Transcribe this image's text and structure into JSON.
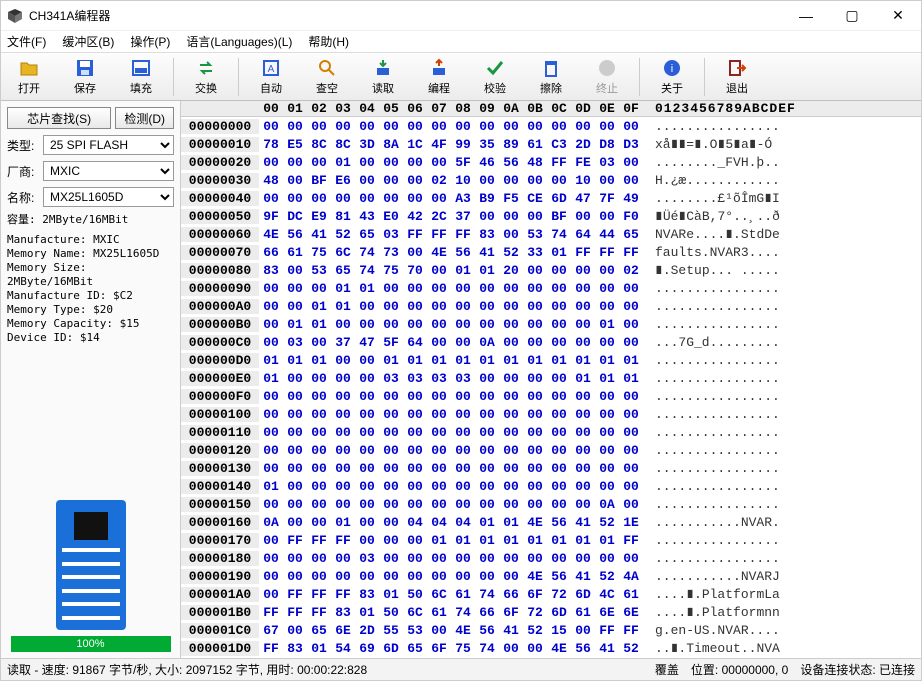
{
  "win": {
    "title": "CH341A编程器"
  },
  "menu": {
    "file": "文件(F)",
    "buffer": "缓冲区(B)",
    "op": "操作(P)",
    "lang": "语言(Languages)(L)",
    "help": "帮助(H)"
  },
  "toolbar": {
    "open": "打开",
    "save": "保存",
    "fill": "填充",
    "swap": "交换",
    "auto": "自动",
    "blank": "查空",
    "read": "读取",
    "prog": "编程",
    "verify": "校验",
    "erase": "擦除",
    "stop": "终止",
    "about": "关于",
    "exit": "退出"
  },
  "left": {
    "search_label": "芯片查找(S)",
    "detect_label": "检测(D)",
    "type_label": "类型:",
    "type_value": "25 SPI FLASH",
    "maker_label": "厂商:",
    "maker_value": "MXIC",
    "name_label": "名称:",
    "name_value": "MX25L1605D",
    "cap": "容量: 2MByte/16MBit",
    "info": "Manufacture: MXIC\nMemory Name: MX25L1605D\nMemory Size: 2MByte/16MBit\nManufacture ID: $C2\nMemory Type: $20\nMemory Capacity: $15\nDevice ID: $14",
    "progress": "100%"
  },
  "hex": {
    "header_bytes": [
      "00",
      "01",
      "02",
      "03",
      "04",
      "05",
      "06",
      "07",
      "08",
      "09",
      "0A",
      "0B",
      "0C",
      "0D",
      "0E",
      "0F"
    ],
    "header_asc": "0123456789ABCDEF",
    "rows": [
      {
        "a": "00000000",
        "b": [
          "00",
          "00",
          "00",
          "00",
          "00",
          "00",
          "00",
          "00",
          "00",
          "00",
          "00",
          "00",
          "00",
          "00",
          "00",
          "00"
        ],
        "s": "................"
      },
      {
        "a": "00000010",
        "b": [
          "78",
          "E5",
          "8C",
          "8C",
          "3D",
          "8A",
          "1C",
          "4F",
          "99",
          "35",
          "89",
          "61",
          "C3",
          "2D",
          "D8",
          "D3"
        ],
        "s": "xå∎∎=∎.O∎5∎a∎-Ó"
      },
      {
        "a": "00000020",
        "b": [
          "00",
          "00",
          "00",
          "01",
          "00",
          "00",
          "00",
          "00",
          "5F",
          "46",
          "56",
          "48",
          "FF",
          "FE",
          "03",
          "00"
        ],
        "s": "........_FVH.þ.."
      },
      {
        "a": "00000030",
        "b": [
          "48",
          "00",
          "BF",
          "E6",
          "00",
          "00",
          "00",
          "02",
          "10",
          "00",
          "00",
          "00",
          "00",
          "10",
          "00",
          "00"
        ],
        "s": "H.¿æ............"
      },
      {
        "a": "00000040",
        "b": [
          "00",
          "00",
          "00",
          "00",
          "00",
          "00",
          "00",
          "00",
          "A3",
          "B9",
          "F5",
          "CE",
          "6D",
          "47",
          "7F",
          "49"
        ],
        "s": "........£¹õÎmG∎I"
      },
      {
        "a": "00000050",
        "b": [
          "9F",
          "DC",
          "E9",
          "81",
          "43",
          "E0",
          "42",
          "2C",
          "37",
          "00",
          "00",
          "00",
          "BF",
          "00",
          "00",
          "F0"
        ],
        "s": "∎Üé∎CàB,7°..¸..ð"
      },
      {
        "a": "00000060",
        "b": [
          "4E",
          "56",
          "41",
          "52",
          "65",
          "03",
          "FF",
          "FF",
          "FF",
          "83",
          "00",
          "53",
          "74",
          "64",
          "44",
          "65"
        ],
        "s": "NVARe....∎.StdDe"
      },
      {
        "a": "00000070",
        "b": [
          "66",
          "61",
          "75",
          "6C",
          "74",
          "73",
          "00",
          "4E",
          "56",
          "41",
          "52",
          "33",
          "01",
          "FF",
          "FF",
          "FF"
        ],
        "s": "faults.NVAR3...."
      },
      {
        "a": "00000080",
        "b": [
          "83",
          "00",
          "53",
          "65",
          "74",
          "75",
          "70",
          "00",
          "01",
          "01",
          "20",
          "00",
          "00",
          "00",
          "00",
          "02"
        ],
        "s": "∎.Setup... ....."
      },
      {
        "a": "00000090",
        "b": [
          "00",
          "00",
          "00",
          "01",
          "01",
          "00",
          "00",
          "00",
          "00",
          "00",
          "00",
          "00",
          "00",
          "00",
          "00",
          "00"
        ],
        "s": "................"
      },
      {
        "a": "000000A0",
        "b": [
          "00",
          "00",
          "01",
          "01",
          "00",
          "00",
          "00",
          "00",
          "00",
          "00",
          "00",
          "00",
          "00",
          "00",
          "00",
          "00"
        ],
        "s": "................"
      },
      {
        "a": "000000B0",
        "b": [
          "00",
          "01",
          "01",
          "00",
          "00",
          "00",
          "00",
          "00",
          "00",
          "00",
          "00",
          "00",
          "00",
          "00",
          "01",
          "00"
        ],
        "s": "................"
      },
      {
        "a": "000000C0",
        "b": [
          "00",
          "03",
          "00",
          "37",
          "47",
          "5F",
          "64",
          "00",
          "00",
          "0A",
          "00",
          "00",
          "00",
          "00",
          "00",
          "00"
        ],
        "s": "...7G_d........."
      },
      {
        "a": "000000D0",
        "b": [
          "01",
          "01",
          "01",
          "00",
          "00",
          "01",
          "01",
          "01",
          "01",
          "01",
          "01",
          "01",
          "01",
          "01",
          "01",
          "01"
        ],
        "s": "................"
      },
      {
        "a": "000000E0",
        "b": [
          "01",
          "00",
          "00",
          "00",
          "00",
          "03",
          "03",
          "03",
          "03",
          "00",
          "00",
          "00",
          "00",
          "01",
          "01",
          "01"
        ],
        "s": "................"
      },
      {
        "a": "000000F0",
        "b": [
          "00",
          "00",
          "00",
          "00",
          "00",
          "00",
          "00",
          "00",
          "00",
          "00",
          "00",
          "00",
          "00",
          "00",
          "00",
          "00"
        ],
        "s": "................"
      },
      {
        "a": "00000100",
        "b": [
          "00",
          "00",
          "00",
          "00",
          "00",
          "00",
          "00",
          "00",
          "00",
          "00",
          "00",
          "00",
          "00",
          "00",
          "00",
          "00"
        ],
        "s": "................"
      },
      {
        "a": "00000110",
        "b": [
          "00",
          "00",
          "00",
          "00",
          "00",
          "00",
          "00",
          "00",
          "00",
          "00",
          "00",
          "00",
          "00",
          "00",
          "00",
          "00"
        ],
        "s": "................"
      },
      {
        "a": "00000120",
        "b": [
          "00",
          "00",
          "00",
          "00",
          "00",
          "00",
          "00",
          "00",
          "00",
          "00",
          "00",
          "00",
          "00",
          "00",
          "00",
          "00"
        ],
        "s": "................"
      },
      {
        "a": "00000130",
        "b": [
          "00",
          "00",
          "00",
          "00",
          "00",
          "00",
          "00",
          "00",
          "00",
          "00",
          "00",
          "00",
          "00",
          "00",
          "00",
          "00"
        ],
        "s": "................"
      },
      {
        "a": "00000140",
        "b": [
          "01",
          "00",
          "00",
          "00",
          "00",
          "00",
          "00",
          "00",
          "00",
          "00",
          "00",
          "00",
          "00",
          "00",
          "00",
          "00"
        ],
        "s": "................"
      },
      {
        "a": "00000150",
        "b": [
          "00",
          "00",
          "00",
          "00",
          "00",
          "00",
          "00",
          "00",
          "00",
          "00",
          "00",
          "00",
          "00",
          "00",
          "0A",
          "00"
        ],
        "s": "................"
      },
      {
        "a": "00000160",
        "b": [
          "0A",
          "00",
          "00",
          "01",
          "00",
          "00",
          "04",
          "04",
          "04",
          "01",
          "01",
          "4E",
          "56",
          "41",
          "52",
          "1E"
        ],
        "s": "...........NVAR."
      },
      {
        "a": "00000170",
        "b": [
          "00",
          "FF",
          "FF",
          "FF",
          "00",
          "00",
          "00",
          "01",
          "01",
          "01",
          "01",
          "01",
          "01",
          "01",
          "01",
          "FF"
        ],
        "s": "................"
      },
      {
        "a": "00000180",
        "b": [
          "00",
          "00",
          "00",
          "00",
          "03",
          "00",
          "00",
          "00",
          "00",
          "00",
          "00",
          "00",
          "00",
          "00",
          "00",
          "00"
        ],
        "s": "................"
      },
      {
        "a": "00000190",
        "b": [
          "00",
          "00",
          "00",
          "00",
          "00",
          "00",
          "00",
          "00",
          "00",
          "00",
          "00",
          "4E",
          "56",
          "41",
          "52",
          "4A"
        ],
        "s": "...........NVARJ"
      },
      {
        "a": "000001A0",
        "b": [
          "00",
          "FF",
          "FF",
          "FF",
          "83",
          "01",
          "50",
          "6C",
          "61",
          "74",
          "66",
          "6F",
          "72",
          "6D",
          "4C",
          "61"
        ],
        "s": "....∎.PlatformLa"
      },
      {
        "a": "000001B0",
        "b": [
          "FF",
          "FF",
          "FF",
          "83",
          "01",
          "50",
          "6C",
          "61",
          "74",
          "66",
          "6F",
          "72",
          "6D",
          "61",
          "6E",
          "6E"
        ],
        "s": "....∎.Platformnn"
      },
      {
        "a": "000001C0",
        "b": [
          "67",
          "00",
          "65",
          "6E",
          "2D",
          "55",
          "53",
          "00",
          "4E",
          "56",
          "41",
          "52",
          "15",
          "00",
          "FF",
          "FF"
        ],
        "s": "g.en-US.NVAR...."
      },
      {
        "a": "000001D0",
        "b": [
          "FF",
          "83",
          "01",
          "54",
          "69",
          "6D",
          "65",
          "6F",
          "75",
          "74",
          "00",
          "00",
          "4E",
          "56",
          "41",
          "52"
        ],
        "s": "..∎.Timeout..NVA"
      }
    ]
  },
  "status": {
    "left": "读取 - 速度: 91867 字节/秒, 大小: 2097152 字节, 用时: 00:00:22:828",
    "mode": "覆盖",
    "pos": "位置: 00000000, 0",
    "conn": "设备连接状态: 已连接"
  }
}
